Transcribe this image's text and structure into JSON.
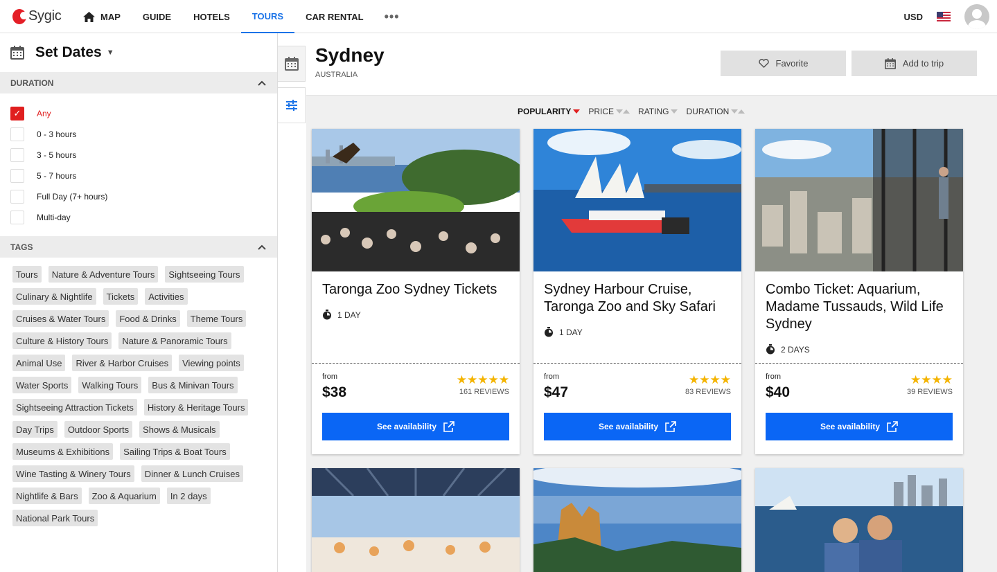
{
  "brand": {
    "name": "Sygic",
    "color": "#e41e26"
  },
  "nav": {
    "items": [
      {
        "label": "MAP",
        "icon": "home-icon"
      },
      {
        "label": "GUIDE"
      },
      {
        "label": "HOTELS"
      },
      {
        "label": "TOURS",
        "active": true
      },
      {
        "label": "CAR RENTAL"
      }
    ],
    "more": "•••",
    "currency": "USD",
    "flag": "us-flag-icon",
    "accent": "#1a73e8"
  },
  "sidebar": {
    "dates_title": "Set Dates",
    "duration": {
      "heading": "DURATION",
      "options": [
        {
          "label": "Any",
          "checked": true
        },
        {
          "label": "0 - 3 hours",
          "checked": false
        },
        {
          "label": "3 - 5 hours",
          "checked": false
        },
        {
          "label": "5 - 7 hours",
          "checked": false
        },
        {
          "label": "Full Day (7+ hours)",
          "checked": false
        },
        {
          "label": "Multi-day",
          "checked": false
        }
      ]
    },
    "tags": {
      "heading": "TAGS",
      "items": [
        "Tours",
        "Nature & Adventure Tours",
        "Sightseeing Tours",
        "Culinary & Nightlife",
        "Tickets",
        "Activities",
        "Cruises & Water Tours",
        "Food & Drinks",
        "Theme Tours",
        "Culture & History Tours",
        "Nature & Panoramic Tours",
        "Animal Use",
        "River & Harbor Cruises",
        "Viewing points",
        "Water Sports",
        "Walking Tours",
        "Bus & Minivan Tours",
        "Sightseeing Attraction Tickets",
        "History & Heritage Tours",
        "Day Trips",
        "Outdoor Sports",
        "Shows & Musicals",
        "Museums & Exhibitions",
        "Sailing Trips & Boat Tours",
        "Wine Tasting & Winery Tours",
        "Dinner & Lunch Cruises",
        "Nightlife & Bars",
        "Zoo & Aquarium",
        "In 2 days",
        "National Park Tours"
      ]
    }
  },
  "header": {
    "city": "Sydney",
    "country": "AUSTRALIA",
    "favorite_label": "Favorite",
    "add_trip_label": "Add to trip"
  },
  "sort": [
    {
      "label": "POPULARITY",
      "active": true
    },
    {
      "label": "PRICE"
    },
    {
      "label": "RATING"
    },
    {
      "label": "DURATION"
    }
  ],
  "cards": [
    {
      "title": "Taronga Zoo Sydney Tickets",
      "duration": "1 DAY",
      "from": "from",
      "price": "$38",
      "stars": "★★★★★",
      "reviews": "161 REVIEWS",
      "cta": "See availability"
    },
    {
      "title": "Sydney Harbour Cruise, Taronga Zoo and Sky Safari",
      "duration": "1 DAY",
      "from": "from",
      "price": "$47",
      "stars": "★★★★",
      "reviews": "83 REVIEWS",
      "cta": "See availability"
    },
    {
      "title": "Combo Ticket: Aquarium, Madame Tussauds, Wild Life Sydney",
      "duration": "2 DAYS",
      "from": "from",
      "price": "$40",
      "stars": "★★★★",
      "reviews": "39 REVIEWS",
      "cta": "See availability"
    }
  ],
  "colors": {
    "primary_button": "#0a66f5",
    "star": "#f4b400",
    "checked": "#e01f1f"
  }
}
